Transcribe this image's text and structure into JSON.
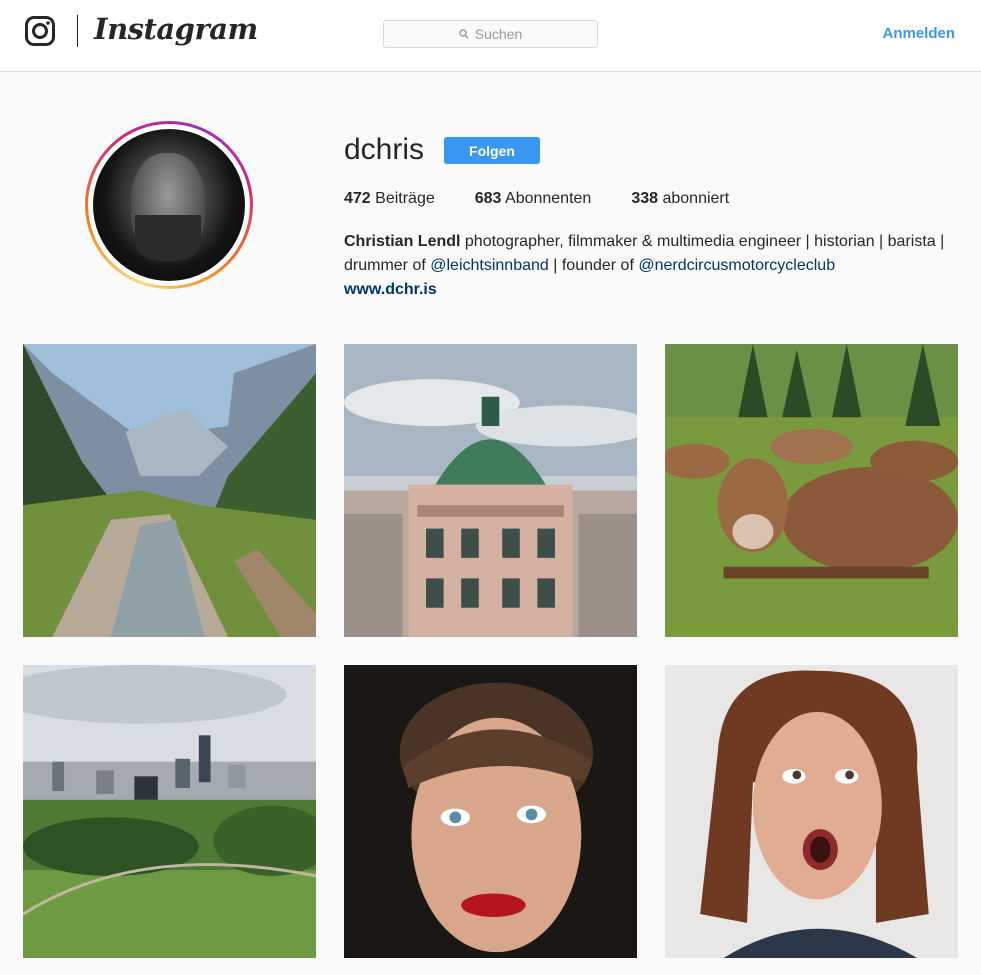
{
  "header": {
    "brand": "Instagram",
    "search_placeholder": "Suchen",
    "login_label": "Anmelden"
  },
  "profile": {
    "username": "dchris",
    "follow_label": "Folgen",
    "stats": {
      "posts_count": "472",
      "posts_label": "Beiträge",
      "followers_count": "683",
      "followers_label": "Abonnenten",
      "following_count": "338",
      "following_label": "abonniert"
    },
    "bio": {
      "full_name": "Christian Lendl",
      "text1": " photographer, filmmaker & multimedia engineer | historian | barista |",
      "text2": "drummer of ",
      "mention1": "@leichtsinnband",
      "text3": " | founder of ",
      "mention2": "@nerdcircusmotorcycleclub",
      "website": "www.dchr.is"
    }
  },
  "posts": [
    {
      "subject": "mountain-stream"
    },
    {
      "subject": "green-dome-building"
    },
    {
      "subject": "cows-on-meadow"
    },
    {
      "subject": "city-skyline-aerial"
    },
    {
      "subject": "woman-portrait-red-lips"
    },
    {
      "subject": "woman-surprised"
    }
  ],
  "colors": {
    "accent": "#3897f0",
    "link": "#003569",
    "text": "#262626",
    "border": "#dbdbdb",
    "background": "#fafafa"
  },
  "icons": {
    "logo": "instagram-camera-icon",
    "search": "search-icon"
  }
}
